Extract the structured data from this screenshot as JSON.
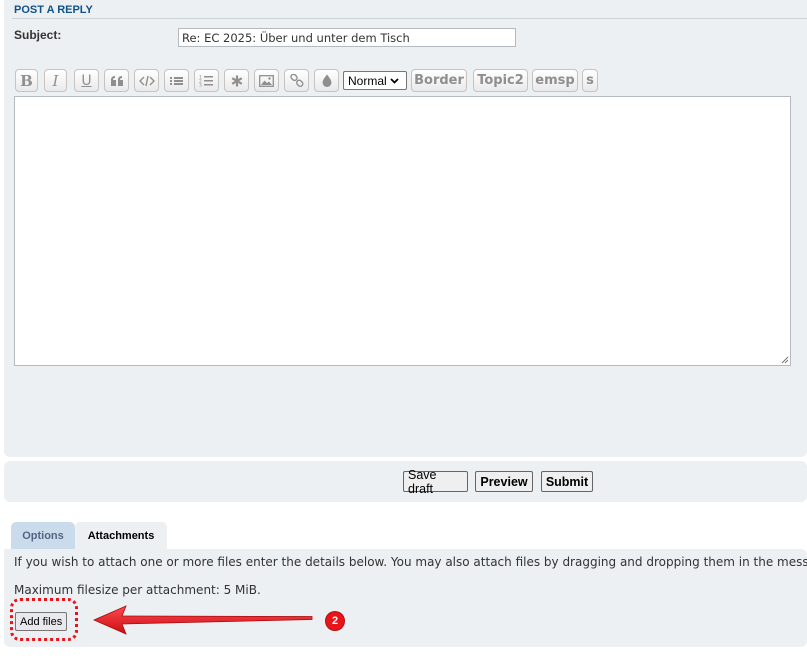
{
  "section": {
    "title": "POST A REPLY"
  },
  "subject": {
    "label": "Subject:",
    "value": "Re: EC 2025: Über und unter dem Tisch"
  },
  "toolbar": {
    "bold": "B",
    "italic": "I",
    "underline": "U",
    "font_size_select": "Normal",
    "custom_buttons": [
      "Border",
      "Topic2",
      "emsp",
      "s"
    ]
  },
  "editor": {
    "value": ""
  },
  "actions": {
    "save_draft": "Save draft",
    "preview": "Preview",
    "submit": "Submit"
  },
  "tabs": [
    {
      "label": "Options",
      "active": false
    },
    {
      "label": "Attachments",
      "active": true
    }
  ],
  "attachments": {
    "help_text": "If you wish to attach one or more files enter the details below. You may also attach files by dragging and dropping them in the message box.",
    "max_size": "Maximum filesize per attachment: 5 MiB.",
    "add_files": "Add files"
  },
  "annotation": {
    "step": "2",
    "color": "#e8141a"
  }
}
